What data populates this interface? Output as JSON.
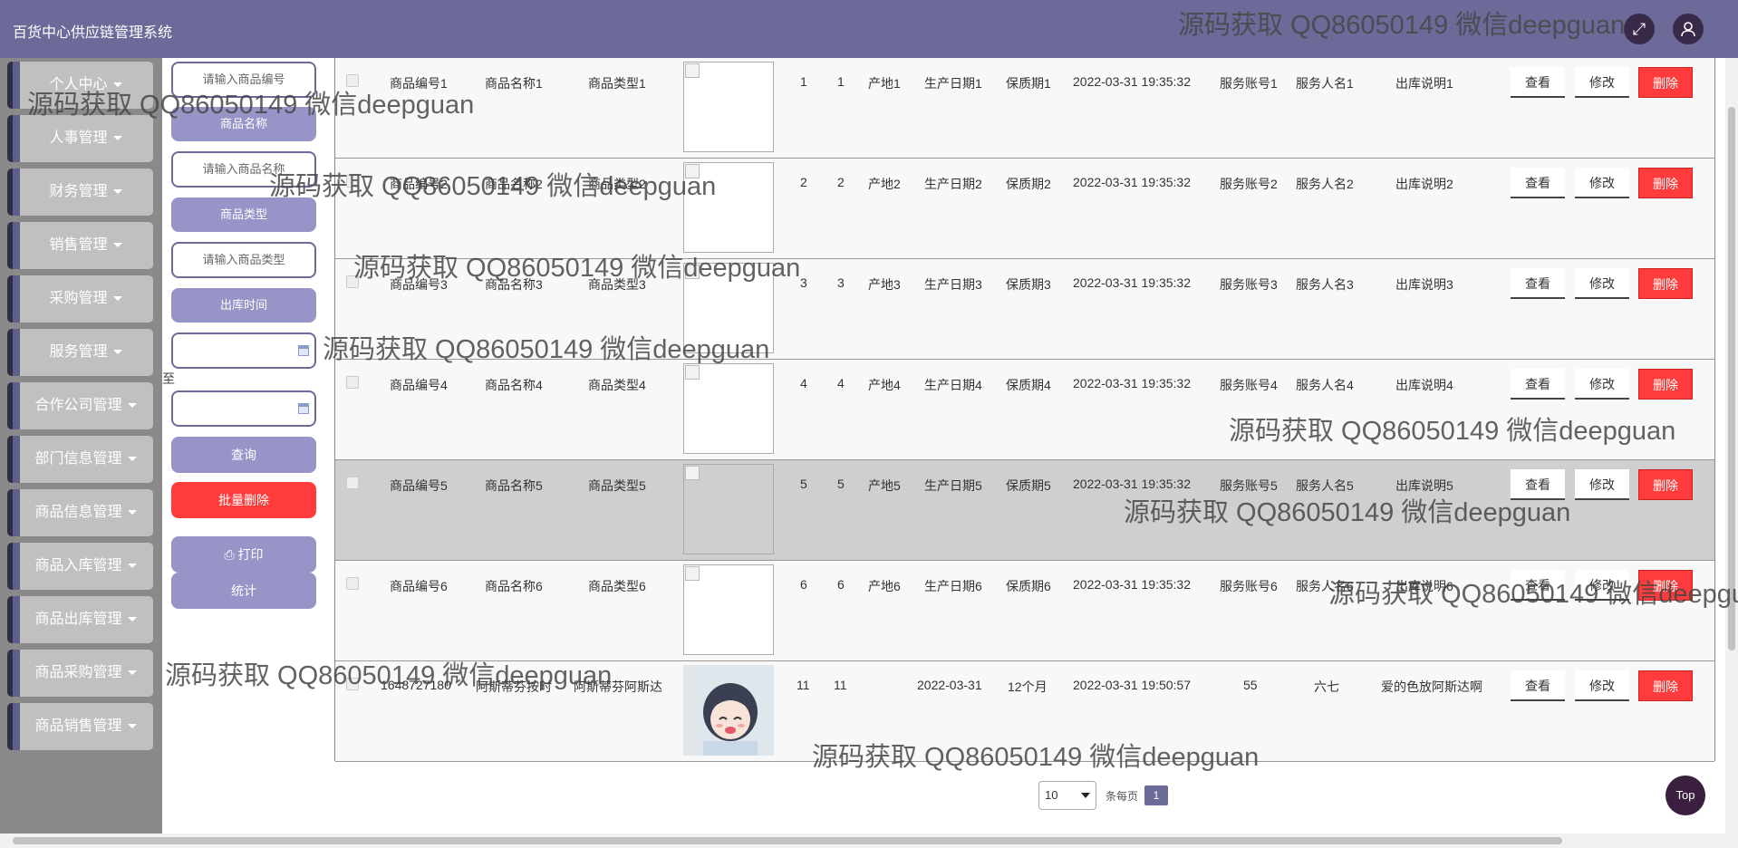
{
  "header": {
    "title": "百货中心供应链管理系统"
  },
  "sidebar": {
    "items": [
      {
        "label": "个人中心"
      },
      {
        "label": "人事管理"
      },
      {
        "label": "财务管理"
      },
      {
        "label": "销售管理"
      },
      {
        "label": "采购管理"
      },
      {
        "label": "服务管理"
      },
      {
        "label": "合作公司管理"
      },
      {
        "label": "部门信息管理"
      },
      {
        "label": "商品信息管理"
      },
      {
        "label": "商品入库管理"
      },
      {
        "label": "商品出库管理"
      },
      {
        "label": "商品采购管理"
      },
      {
        "label": "商品销售管理"
      }
    ]
  },
  "filter": {
    "code_placeholder": "请输入商品编号",
    "name_label": "商品名称",
    "name_placeholder": "请输入商品名称",
    "type_label": "商品类型",
    "type_placeholder": "请输入商品类型",
    "time_label": "出库时间",
    "to_label": "至",
    "query_label": "查询",
    "batch_delete_label": "批量删除",
    "print_label": "打印",
    "stats_label": "统计"
  },
  "table": {
    "actions": {
      "view": "查看",
      "edit": "修改",
      "delete": "删除"
    },
    "rows": [
      {
        "code": "商品编号1",
        "name": "商品名称1",
        "type": "商品类型1",
        "a": "1",
        "b": "1",
        "origin": "产地1",
        "prod_date": "生产日期1",
        "shelf": "保质期1",
        "time": "2022-03-31 19:35:32",
        "acct": "服务账号1",
        "person": "服务人名1",
        "note": "出库说明1"
      },
      {
        "code": "商品编号2",
        "name": "商品名称2",
        "type": "商品类型2",
        "a": "2",
        "b": "2",
        "origin": "产地2",
        "prod_date": "生产日期2",
        "shelf": "保质期2",
        "time": "2022-03-31 19:35:32",
        "acct": "服务账号2",
        "person": "服务人名2",
        "note": "出库说明2"
      },
      {
        "code": "商品编号3",
        "name": "商品名称3",
        "type": "商品类型3",
        "a": "3",
        "b": "3",
        "origin": "产地3",
        "prod_date": "生产日期3",
        "shelf": "保质期3",
        "time": "2022-03-31 19:35:32",
        "acct": "服务账号3",
        "person": "服务人名3",
        "note": "出库说明3"
      },
      {
        "code": "商品编号4",
        "name": "商品名称4",
        "type": "商品类型4",
        "a": "4",
        "b": "4",
        "origin": "产地4",
        "prod_date": "生产日期4",
        "shelf": "保质期4",
        "time": "2022-03-31 19:35:32",
        "acct": "服务账号4",
        "person": "服务人名4",
        "note": "出库说明4"
      },
      {
        "code": "商品编号5",
        "name": "商品名称5",
        "type": "商品类型5",
        "a": "5",
        "b": "5",
        "origin": "产地5",
        "prod_date": "生产日期5",
        "shelf": "保质期5",
        "time": "2022-03-31 19:35:32",
        "acct": "服务账号5",
        "person": "服务人名5",
        "note": "出库说明5"
      },
      {
        "code": "商品编号6",
        "name": "商品名称6",
        "type": "商品类型6",
        "a": "6",
        "b": "6",
        "origin": "产地6",
        "prod_date": "生产日期6",
        "shelf": "保质期6",
        "time": "2022-03-31 19:35:32",
        "acct": "服务账号6",
        "person": "服务人名6",
        "note": "出库说明6"
      },
      {
        "code": "1648727180",
        "name": "阿斯蒂芬按时",
        "type": "阿斯蒂芬阿斯达",
        "a": "11",
        "b": "11",
        "origin": "",
        "prod_date": "2022-03-31",
        "shelf": "12个月",
        "time": "2022-03-31 19:50:57",
        "acct": "55",
        "person": "六七",
        "note": "爱的色放阿斯达啊"
      }
    ]
  },
  "pagination": {
    "page_size": "10",
    "per_page_label": "条每页",
    "current_page": "1"
  },
  "top_button": "Top",
  "watermark": "源码获取 QQ86050149 微信deepguan",
  "icons": {
    "expand": "expand-icon",
    "user": "user-icon",
    "print": "printer-icon",
    "calendar": "calendar-icon"
  },
  "colors": {
    "header": "#6b6a99",
    "accent": "#9795c8",
    "danger": "#ff3b3b"
  }
}
